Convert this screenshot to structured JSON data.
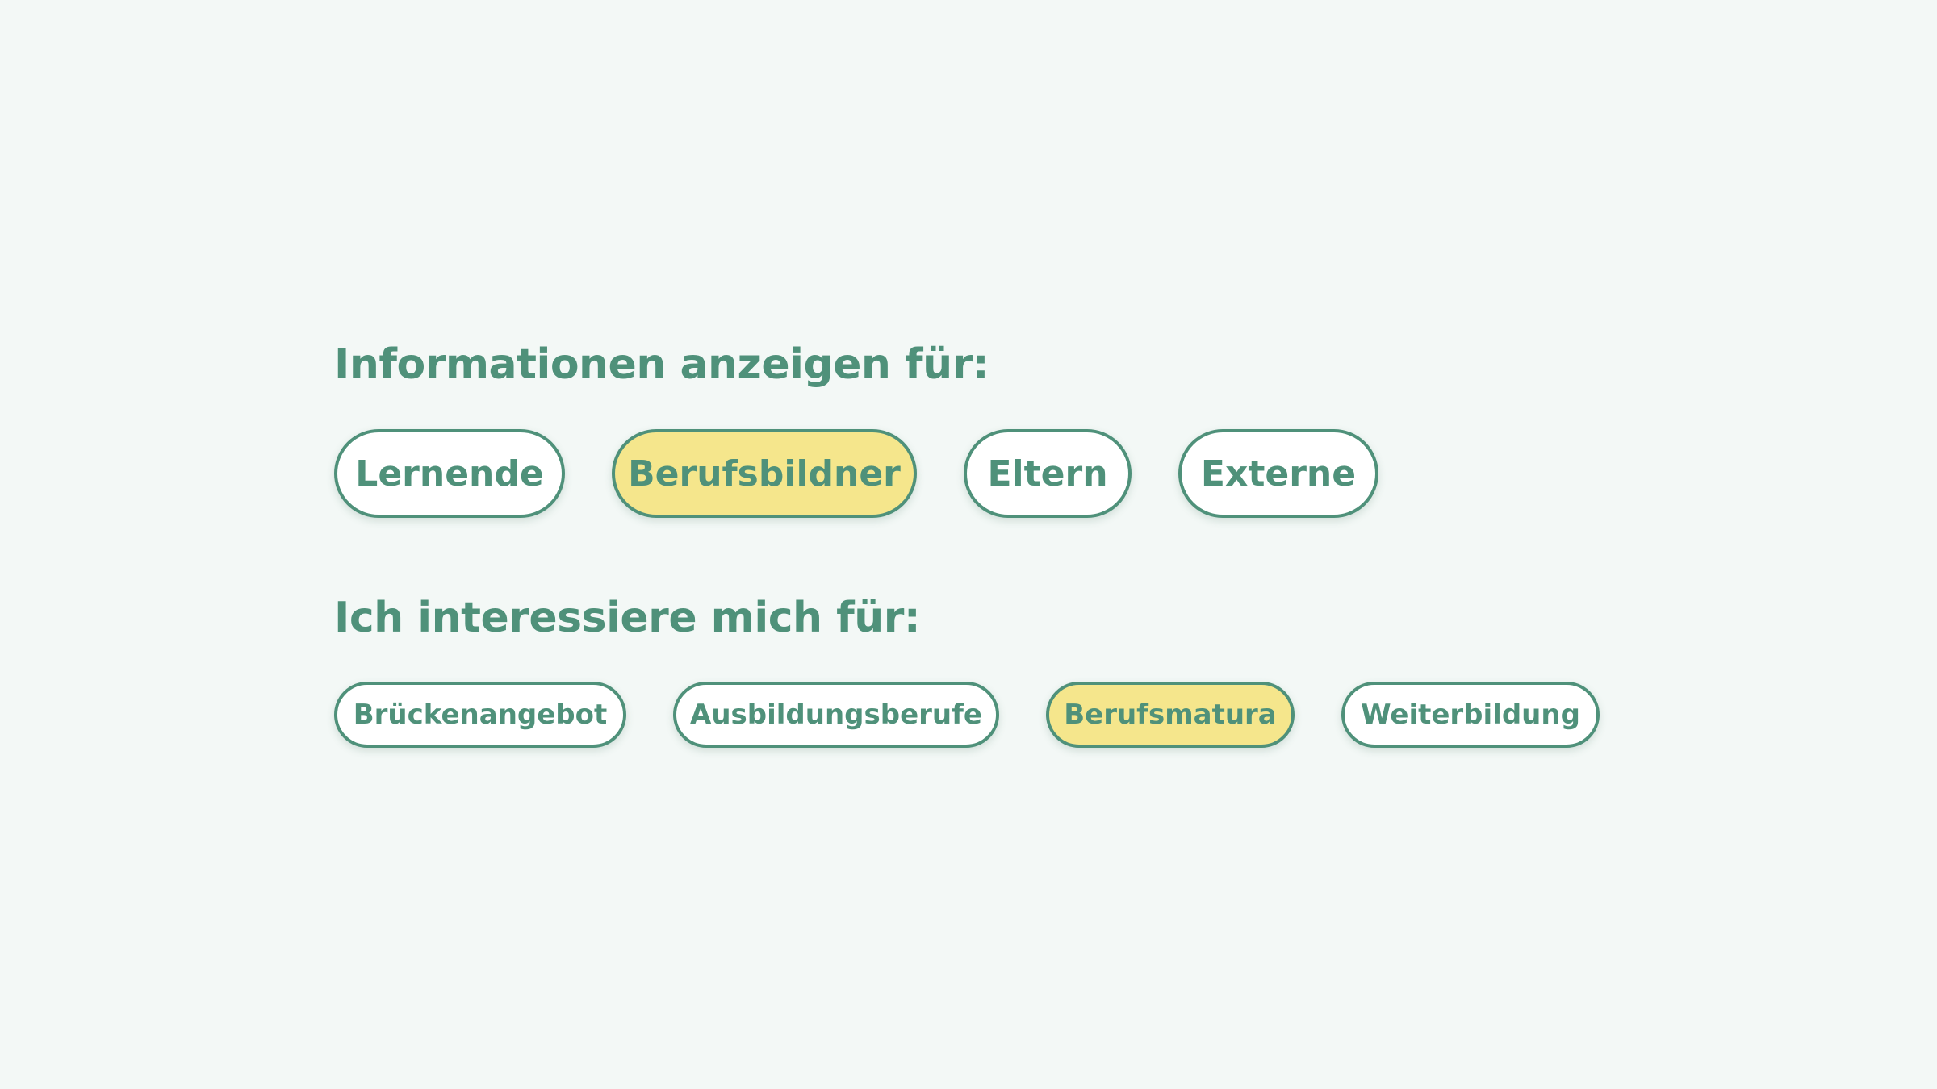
{
  "audience": {
    "heading": "Informationen anzeigen für:",
    "options": [
      {
        "label": "Lernende",
        "selected": false
      },
      {
        "label": "Berufsbildner",
        "selected": true
      },
      {
        "label": "Eltern",
        "selected": false
      },
      {
        "label": "Externe",
        "selected": false
      }
    ]
  },
  "interests": {
    "heading": "Ich interessiere mich für:",
    "options": [
      {
        "label": "Brückenangebot",
        "selected": false
      },
      {
        "label": "Ausbildungsberufe",
        "selected": false
      },
      {
        "label": "Berufsmatura",
        "selected": true
      },
      {
        "label": "Weiterbildung",
        "selected": false
      }
    ]
  },
  "colors": {
    "background": "#f3f8f6",
    "accent": "#4f917a",
    "selected_fill": "#f5e68c",
    "chip_fill": "#ffffff"
  }
}
